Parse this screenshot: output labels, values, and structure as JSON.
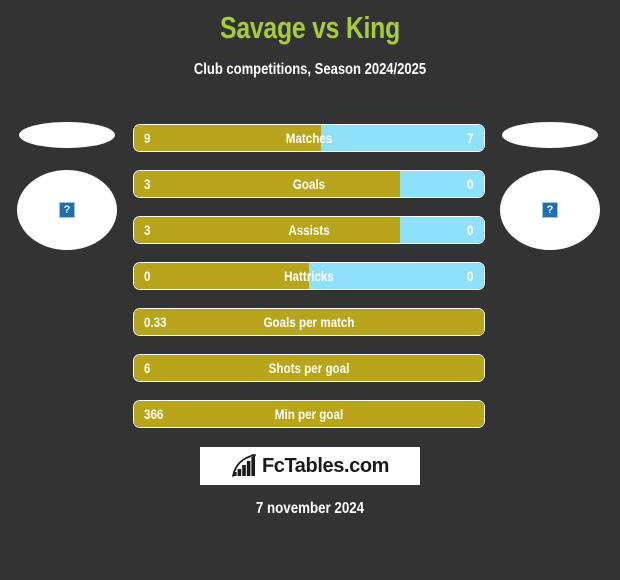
{
  "header": {
    "title": "Savage vs King",
    "subtitle": "Club competitions, Season 2024/2025"
  },
  "colors": {
    "background": "#333333",
    "title": "#a5cd39",
    "home_bar": "#b9a51c",
    "away_bar": "#8fe0fb",
    "outline": "#ffffff",
    "broken_image": "#1c6fb0"
  },
  "players": {
    "left": {
      "flag": "flag-placeholder",
      "photo": "broken-image-placeholder"
    },
    "right": {
      "flag": "flag-placeholder",
      "photo": "broken-image-placeholder"
    }
  },
  "chart_data": {
    "type": "bar",
    "title": "Savage vs King",
    "subtitle": "Club competitions, Season 2024/2025",
    "xlabel": "",
    "ylabel": "",
    "legend_position": "none",
    "grid": false,
    "categories": [
      "Matches",
      "Goals",
      "Assists",
      "Hattricks",
      "Goals per match",
      "Shots per goal",
      "Min per goal"
    ],
    "series": [
      {
        "name": "Savage",
        "values": [
          9,
          3,
          3,
          0,
          0.33,
          6,
          366
        ]
      },
      {
        "name": "King",
        "values": [
          7,
          0,
          0,
          0,
          null,
          null,
          null
        ]
      }
    ],
    "rows": [
      {
        "label": "Matches",
        "left_value": "9",
        "right_value": "7",
        "left_pct": 53.5,
        "split": true
      },
      {
        "label": "Goals",
        "left_value": "3",
        "right_value": "0",
        "left_pct": 76.0,
        "split": true
      },
      {
        "label": "Assists",
        "left_value": "3",
        "right_value": "0",
        "left_pct": 76.0,
        "split": true
      },
      {
        "label": "Hattricks",
        "left_value": "0",
        "right_value": "0",
        "left_pct": 50.0,
        "split": true
      },
      {
        "label": "Goals per match",
        "left_value": "0.33",
        "right_value": "",
        "left_pct": 100,
        "split": false
      },
      {
        "label": "Shots per goal",
        "left_value": "6",
        "right_value": "",
        "left_pct": 100,
        "split": false
      },
      {
        "label": "Min per goal",
        "left_value": "366",
        "right_value": "",
        "left_pct": 100,
        "split": false
      }
    ]
  },
  "footer": {
    "logo_text": "FcTables.com",
    "logo_icon": "bar-chart-growth-icon",
    "date": "7 november 2024"
  }
}
